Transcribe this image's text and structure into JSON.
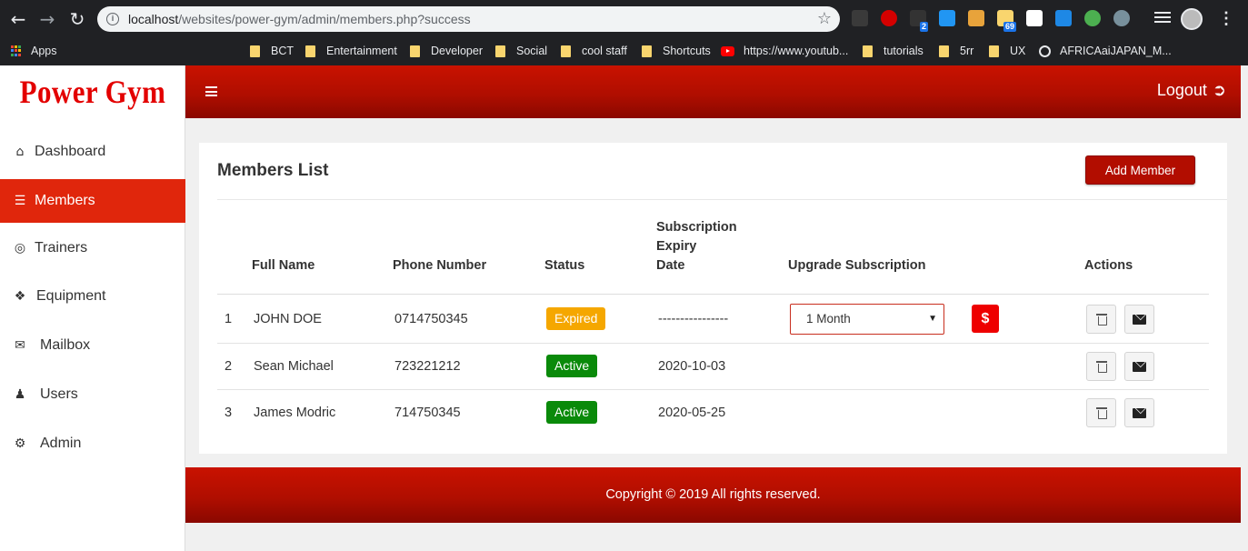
{
  "browser": {
    "url_host": "localhost",
    "url_path": "/websites/power-gym/admin/members.php?success",
    "bookmarks": [
      "Apps",
      "BCT",
      "Entertainment",
      "Developer",
      "Social",
      "cool staff",
      "Shortcuts",
      "https://www.youtub...",
      "tutorials",
      "5rr",
      "UX",
      "AFRICAaiJAPAN_M..."
    ],
    "ext_badges": [
      "2",
      "69"
    ]
  },
  "sidebar": {
    "brand": "Power Gym",
    "items": [
      {
        "label": "Dashboard",
        "icon": "home-icon"
      },
      {
        "label": "Members",
        "icon": "list-icon"
      },
      {
        "label": "Trainers",
        "icon": "life-ring-icon"
      },
      {
        "label": "Equipment",
        "icon": "tags-icon"
      },
      {
        "label": "Mailbox",
        "icon": "envelope-icon"
      },
      {
        "label": "Users",
        "icon": "user-icon"
      },
      {
        "label": "Admin",
        "icon": "gear-icon"
      }
    ]
  },
  "header": {
    "logout_label": "Logout"
  },
  "main": {
    "title": "Members List",
    "add_button": "Add Member",
    "columns": {
      "full_name": "Full Name",
      "phone": "Phone Number",
      "status": "Status",
      "expiry_1": "Subscription",
      "expiry_2": "Expiry",
      "expiry_3": "Date",
      "upgrade": "Upgrade Subscription",
      "actions": "Actions"
    },
    "rows": [
      {
        "num": "1",
        "name": "JOHN DOE",
        "phone": "0714750345",
        "status": "Expired",
        "expiry": "----------------",
        "upgrade_value": "1 Month",
        "pay_symbol": "$"
      },
      {
        "num": "2",
        "name": "Sean Michael",
        "phone": "723221212",
        "status": "Active",
        "expiry": "2020-10-03"
      },
      {
        "num": "3",
        "name": "James Modric",
        "phone": "714750345",
        "status": "Active",
        "expiry": "2020-05-25"
      }
    ]
  },
  "footer": {
    "text": "Copyright © 2019 All rights reserved."
  },
  "colors": {
    "brand_red": "#e30000",
    "header_red": "#b00e00",
    "active_nav": "#e0260c",
    "expired_badge": "#f5a700",
    "active_badge": "#0a8a0a"
  }
}
